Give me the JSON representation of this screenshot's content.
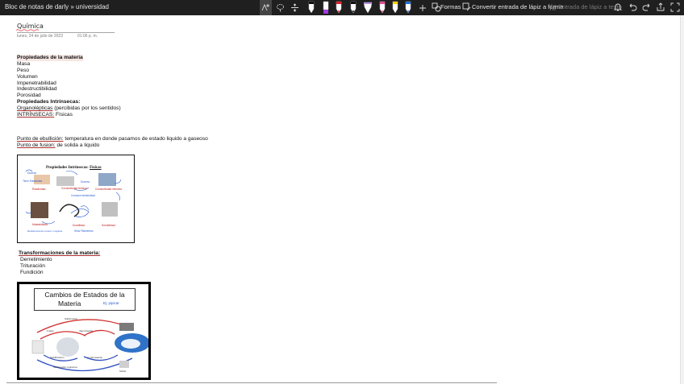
{
  "app": {
    "title": "Bloc de notas de darly » universidad"
  },
  "toolbar": {
    "shapes_label": "Formas",
    "convert_ink_label": "Convertir entrada de lápiz a forma",
    "ink_to_text_label": "Entrada de lápiz a texto",
    "pens": [
      {
        "name": "pen-black",
        "color": "#111111"
      },
      {
        "name": "highlighter-purple",
        "color": "#a33be0"
      },
      {
        "name": "pen-red",
        "color": "#e0202a"
      },
      {
        "name": "pen-black-2",
        "color": "#111111"
      },
      {
        "name": "pen-purple-light",
        "color": "#b58ee0"
      },
      {
        "name": "pen-pink",
        "color": "#e04d8f"
      },
      {
        "name": "pen-yellow",
        "color": "#ffd200"
      },
      {
        "name": "pen-blue",
        "color": "#1f6fd6"
      }
    ]
  },
  "page": {
    "title": "Química",
    "date": "lunes, 24 de julio de 2023",
    "time": "01:06 p. m."
  },
  "notes": {
    "heading_properties": "Propiedades de la materia",
    "properties": [
      "Masa",
      "Peso",
      "Volumen",
      "Impenetrabilidad",
      "Indestructibilidad",
      "Porosidad"
    ],
    "intrinsic_heading": " Propiedades Intrínsecas:",
    "organoleptic_term": "Organolépticas",
    "organoleptic_rest": " (percibidas por los sentidos)",
    "intrinsic_term": "INTRÍNSECAS:",
    "intrinsic_rest": " Físicas",
    "boiling_term": "Punto de ebullición:",
    "boiling_rest": " temperatura en donde pasamos de estado liquido a gaseoso",
    "fusion_term": "Punto de fusion:",
    "fusion_rest": " de solida a liquido",
    "transformations_heading": "Transformaciones de la materia:",
    "transformations": [
      "Derretimiento",
      "Trituración",
      "Fundición"
    ]
  },
  "image1": {
    "title": "Propiedades Intrínsecas:",
    "title_suffix": "Físicas",
    "captions": [
      "Dureza",
      "Dureza",
      "Elasticidad",
      "Conductividad térmica",
      "Conductividad eléctrica",
      "Maleabilidad",
      "Ductilidad",
      "Solubilidad",
      "Tiene Elasticidad",
      "Conducir electricidad",
      "Hilos Filamentos",
      "Resistencia de romper o rayarse"
    ]
  },
  "image2": {
    "title_line1": "Cambios de Estados de la",
    "title_line2": "Materia",
    "title_note": "Ej: pipicar",
    "labels": [
      "Sublimación",
      "Fusión",
      "Vaporización",
      "Solidificación",
      "Condensación",
      "Sublimación regresiva",
      "Sólido"
    ]
  }
}
